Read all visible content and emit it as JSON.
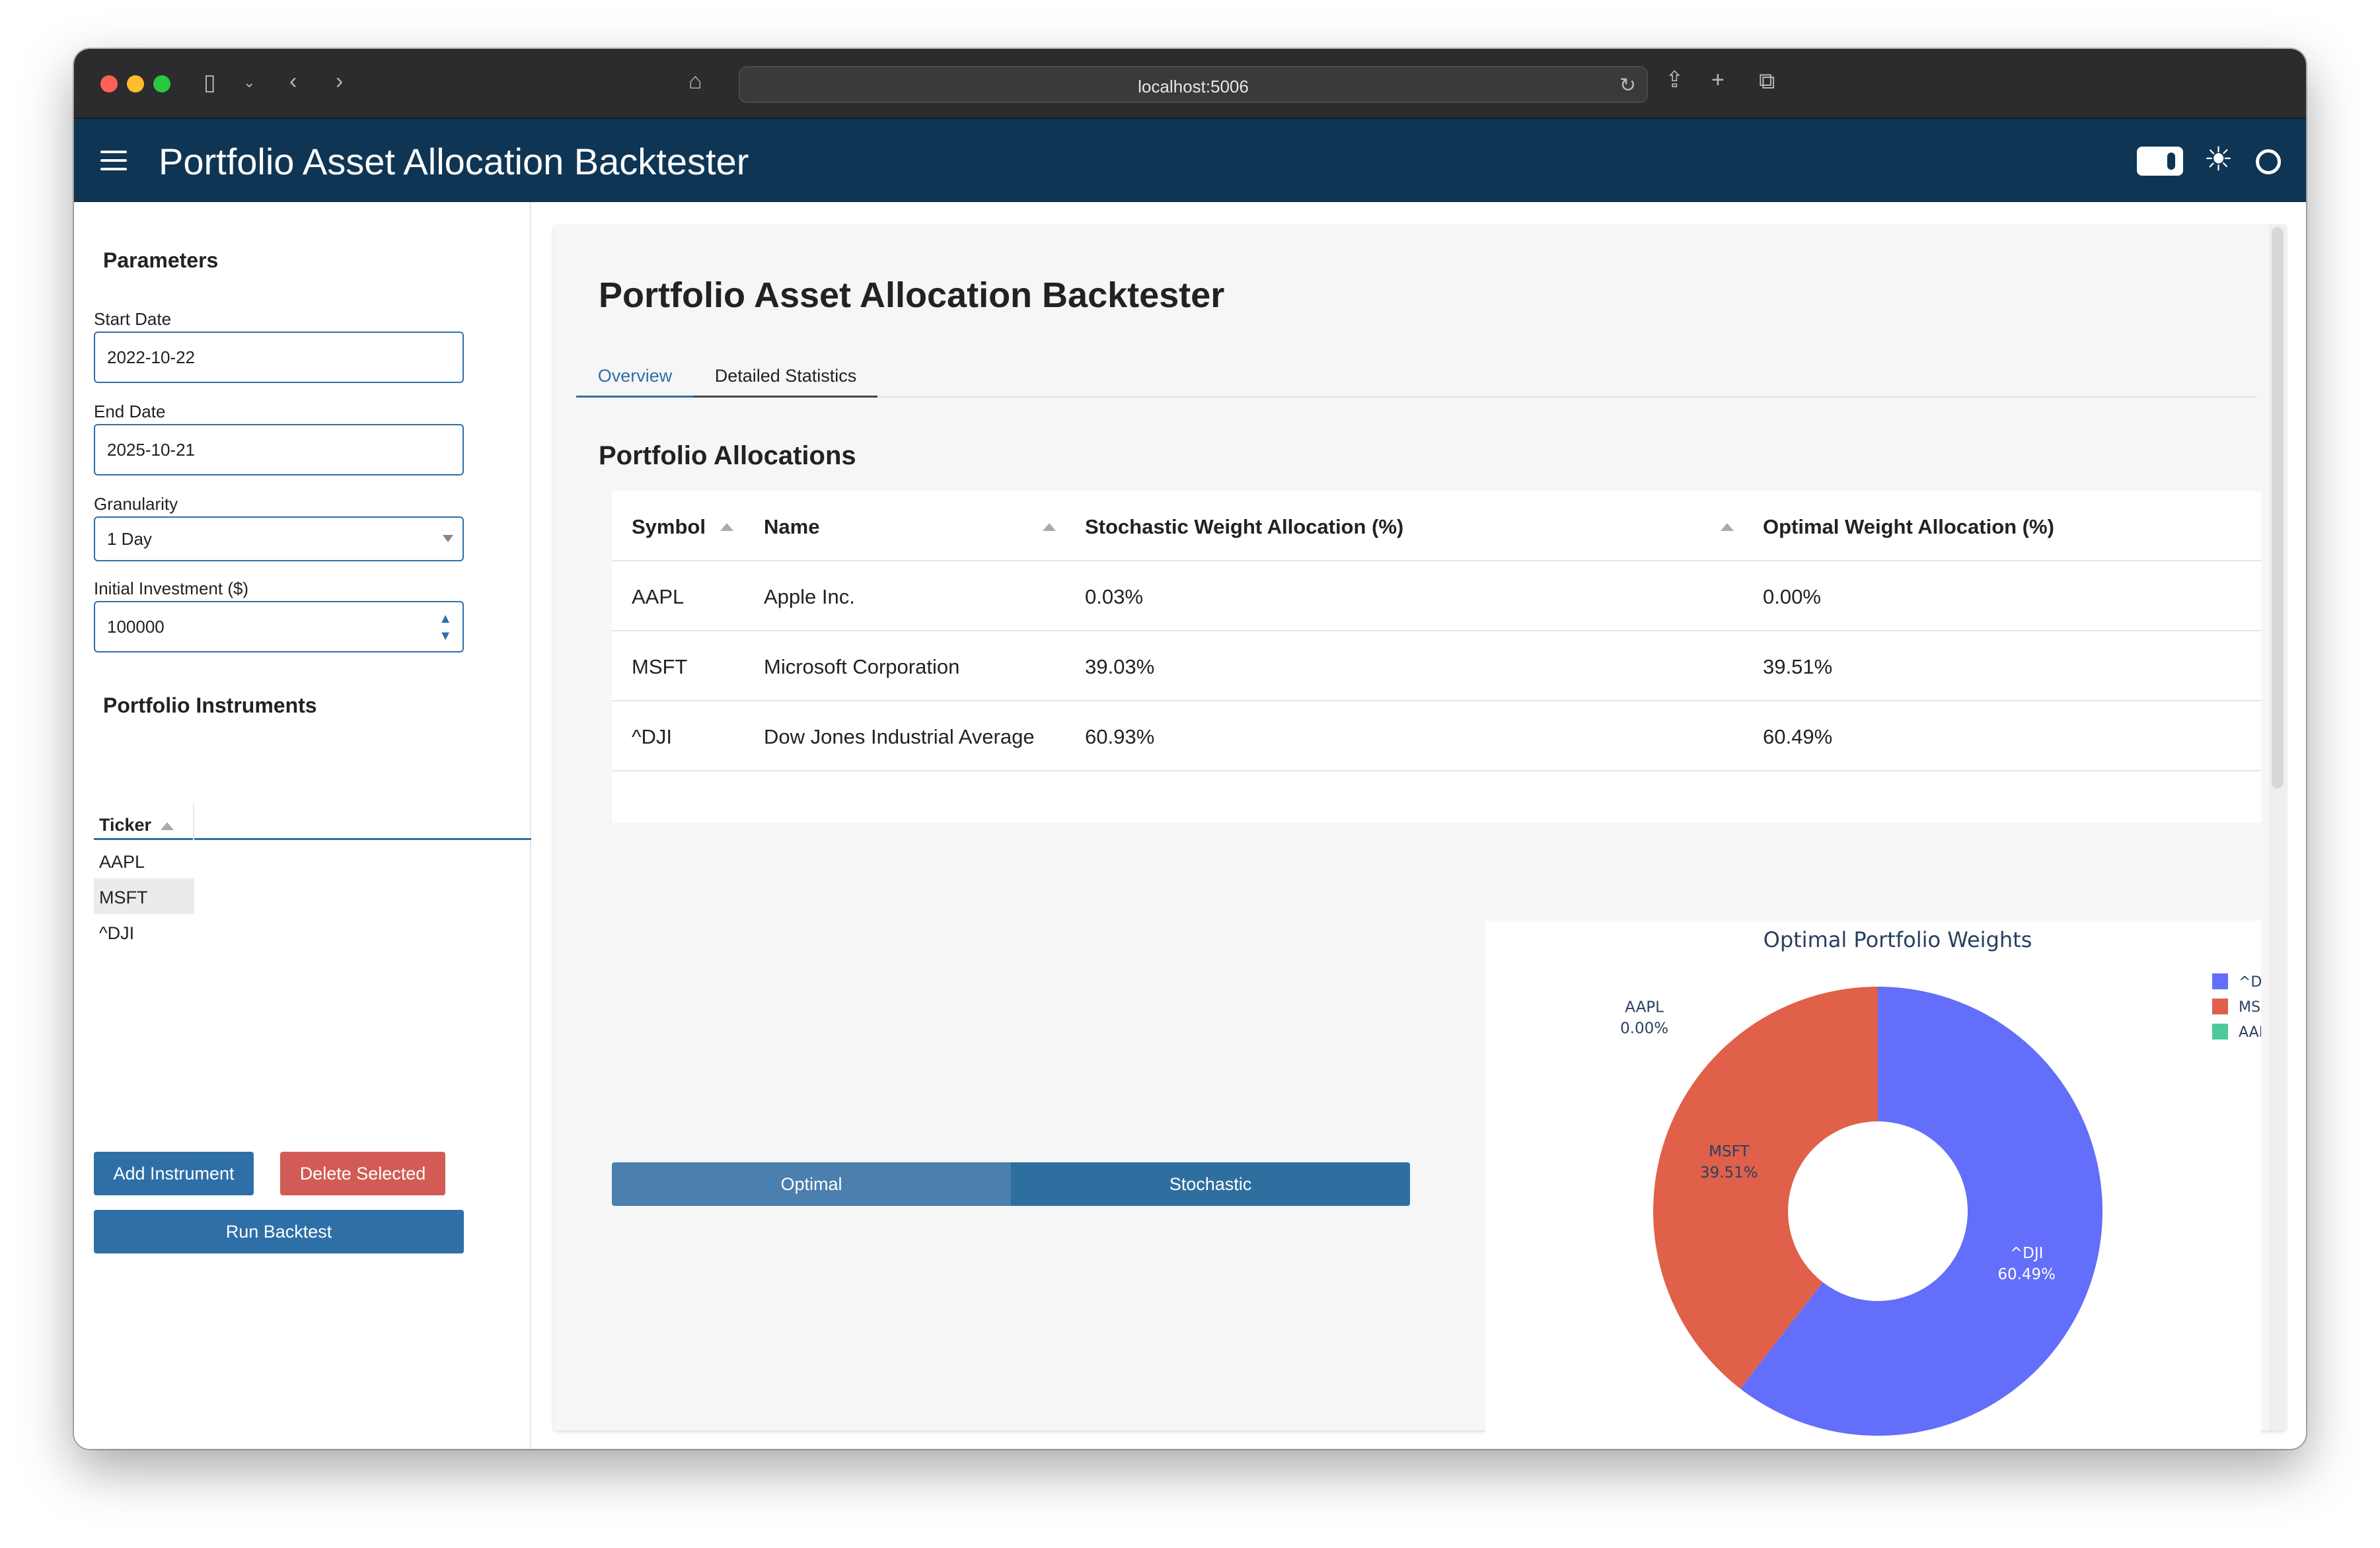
{
  "browser": {
    "url": "localhost:5006"
  },
  "header": {
    "title": "Portfolio Asset Allocation Backtester"
  },
  "sidebar": {
    "parameters_title": "Parameters",
    "start_date_label": "Start Date",
    "start_date_value": "2022-10-22",
    "end_date_label": "End Date",
    "end_date_value": "2025-10-21",
    "granularity_label": "Granularity",
    "granularity_value": "1 Day",
    "investment_label": "Initial Investment ($)",
    "investment_value": "100000",
    "instruments_title": "Portfolio Instruments",
    "ticker_header": "Ticker",
    "tickers": [
      "AAPL",
      "MSFT",
      "^DJI"
    ],
    "selected_ticker": "MSFT",
    "add_button": "Add Instrument",
    "delete_button": "Delete Selected",
    "run_button": "Run Backtest"
  },
  "main": {
    "title": "Portfolio Asset Allocation Backtester",
    "tabs": [
      "Overview",
      "Detailed Statistics"
    ],
    "active_tab": "Overview",
    "allocations_title": "Portfolio Allocations",
    "table": {
      "headers": [
        "Symbol",
        "Name",
        "Stochastic Weight Allocation (%)",
        "Optimal Weight Allocation (%)"
      ],
      "rows": [
        [
          "AAPL",
          "Apple Inc.",
          "0.03%",
          "0.00%"
        ],
        [
          "MSFT",
          "Microsoft Corporation",
          "39.03%",
          "39.51%"
        ],
        [
          "^DJI",
          "Dow Jones Industrial Average",
          "60.93%",
          "60.49%"
        ]
      ]
    },
    "toggle": {
      "optimal": "Optimal",
      "stochastic": "Stochastic"
    }
  },
  "colors": {
    "header_bg": "#0f3554",
    "primary": "#2f6fa8",
    "danger": "#d25c55",
    "dji": "#636efa",
    "msft": "#e0604a",
    "aapl": "#4dc99a"
  },
  "chart_data": {
    "type": "pie",
    "title": "Optimal Portfolio Weights",
    "hole": 0.4,
    "slices": [
      {
        "label": "^DJI",
        "value": 60.49,
        "text": "60.49%",
        "color": "#636efa"
      },
      {
        "label": "MSFT",
        "value": 39.51,
        "text": "39.51%",
        "color": "#e0604a"
      },
      {
        "label": "AAPL",
        "value": 0.0,
        "text": "0.00%",
        "color": "#4dc99a"
      }
    ],
    "legend": [
      "^DJI",
      "MSFT",
      "AAPL"
    ],
    "legend_position": "top-right"
  }
}
